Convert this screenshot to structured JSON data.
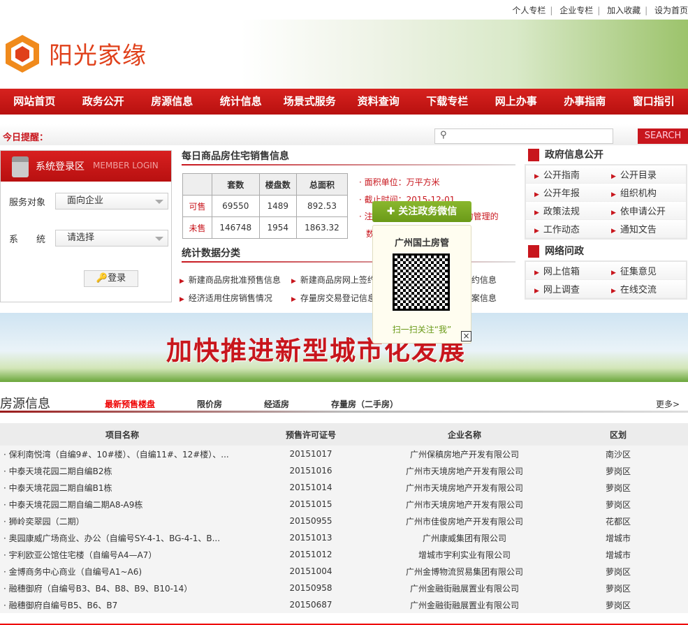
{
  "top_links": [
    "个人专栏",
    "企业专栏",
    "加入收藏",
    "设为首页"
  ],
  "logo_text": "阳光家缘",
  "nav": [
    "网站首页",
    "政务公开",
    "房源信息",
    "统计信息",
    "场景式服务",
    "资料查询",
    "下载专栏",
    "网上办事",
    "办事指南",
    "窗口指引"
  ],
  "reminder_label": "今日提醒：",
  "search": {
    "placeholder": "",
    "button": "SEARCH"
  },
  "login": {
    "title": "系统登录区",
    "subtitle": "MEMBER LOGIN",
    "service_label": "服务对象",
    "service_value": "面向企业",
    "system_label": "系　　统",
    "system_value": "请选择",
    "button": "登录"
  },
  "sales": {
    "title": "每日商品房住宅销售信息",
    "headers": [
      "",
      "套数",
      "楼盘数",
      "总面积"
    ],
    "rows": [
      {
        "label": "可售",
        "sets": "69550",
        "projects": "1489",
        "area": "892.53"
      },
      {
        "label": "未售",
        "sets": "146748",
        "projects": "1954",
        "area": "1863.32"
      }
    ],
    "notes": [
      "面积单位：万平方米",
      "截止时间：2015-12-01",
      "注：以上数据为纳入网上签约管理的",
      "数据"
    ]
  },
  "stats": {
    "title": "统计数据分类",
    "links": [
      "新建商品房批准预售信息",
      "新建商品房网上签约信息",
      "存量房网上签约信息",
      "经济适用住房销售情况",
      "存量房交易登记信息",
      "新建商品房备案信息"
    ]
  },
  "gov": {
    "title": "政府信息公开",
    "items": [
      "公开指南",
      "公开目录",
      "公开年报",
      "组织机构",
      "政策法规",
      "依申请公开",
      "工作动态",
      "通知文告"
    ]
  },
  "net": {
    "title": "网络问政",
    "items": [
      "网上信箱",
      "征集意见",
      "网上调查",
      "在线交流"
    ]
  },
  "popup": {
    "button": "关注政务微信",
    "title": "广州国土房管",
    "caption": "扫一扫关注“我”",
    "close": "×"
  },
  "banner_text": "加快推进新型城市化发展",
  "houses": {
    "title": "房源信息",
    "tabs": [
      "最新预售楼盘",
      "限价房",
      "经适房",
      "存量房（二手房）"
    ],
    "more": "更多>",
    "headers": [
      "项目名称",
      "预售许可证号",
      "企业名称",
      "区划"
    ],
    "rows": [
      [
        "保利南悦湾（自编9#、10#楼）、（自编11#、12#楼）、...",
        "20151017",
        "广州保稹房地产开发有限公司",
        "南沙区"
      ],
      [
        "中泰天境花园二期自编B2栋",
        "20151016",
        "广州市天境房地产开发有限公司",
        "萝岗区"
      ],
      [
        "中泰天境花园二期自编B1栋",
        "20151014",
        "广州市天境房地产开发有限公司",
        "萝岗区"
      ],
      [
        "中泰天境花园二期自编二期A8-A9栋",
        "20151015",
        "广州市天境房地产开发有限公司",
        "萝岗区"
      ],
      [
        "狮岭奕翠园（二期）",
        "20150955",
        "广州市佳俊房地产开发有限公司",
        "花都区"
      ],
      [
        "奥园康威广场商业、办公（自编号SY-4-1、BG-4-1、B...",
        "20151013",
        "广州康威集团有限公司",
        "增城市"
      ],
      [
        "宇利欧亚公馆住宅楼（自编号A4—A7）",
        "20151012",
        "增城市宇利实业有限公司",
        "增城市"
      ],
      [
        "金博商务中心商业（自编号A1~A6)",
        "20151004",
        "广州金博物流贸易集团有限公司",
        "萝岗区"
      ],
      [
        "融穗御府（自编号B3、B4、B8、B9、B10-14）",
        "20150958",
        "广州金融街融展置业有限公司",
        "萝岗区"
      ],
      [
        "融穗御府自编号B5、B6、B7",
        "20150687",
        "广州金融街融展置业有限公司",
        "萝岗区"
      ]
    ]
  }
}
